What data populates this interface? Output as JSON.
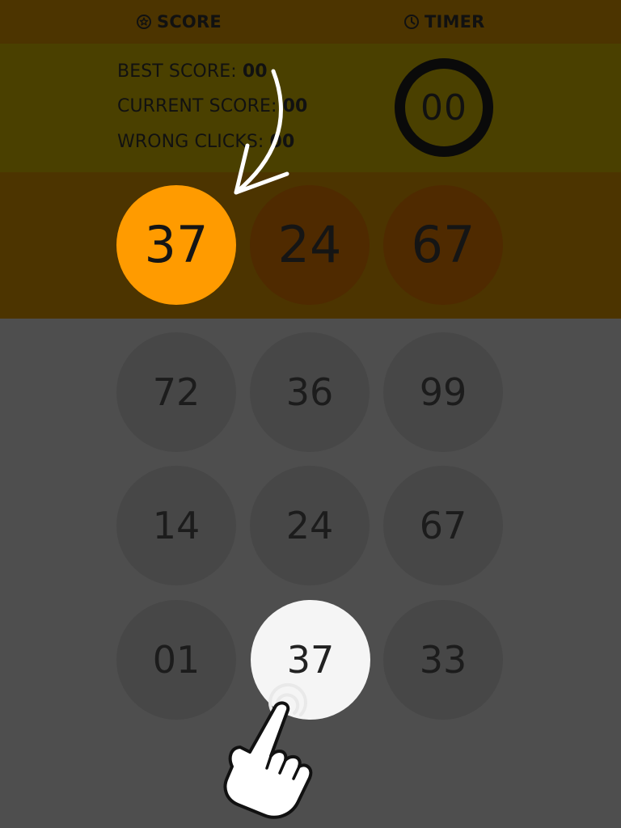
{
  "header": {
    "score_label": "SCORE",
    "score_icon": "star-circle-icon",
    "timer_label": "TIMER",
    "timer_icon": "clock-icon"
  },
  "stats": {
    "best_label": "BEST SCORE: ",
    "best_value": "00",
    "current_label": "CURRENT SCORE: ",
    "current_value": "00",
    "wrong_label": "WRONG CLICKS: ",
    "wrong_value": "00"
  },
  "timer": {
    "value": "00"
  },
  "targets": [
    {
      "number": "37",
      "state": "active"
    },
    {
      "number": "24",
      "state": "idle"
    },
    {
      "number": "67",
      "state": "idle"
    }
  ],
  "grid": [
    [
      "72",
      "36",
      "99"
    ],
    [
      "14",
      "24",
      "67"
    ],
    [
      "01",
      "37",
      "33"
    ]
  ],
  "highlighted_cell": "37",
  "colors": {
    "header_band": "#4c3400",
    "stats_band": "#4a4000",
    "active_target": "#ff9b00",
    "idle_target": "#4f2a00",
    "board": "#4e4e4e",
    "highlight": "#f5f5f5"
  },
  "overlay_icons": [
    "curved-arrow-icon",
    "tap-hand-icon"
  ]
}
